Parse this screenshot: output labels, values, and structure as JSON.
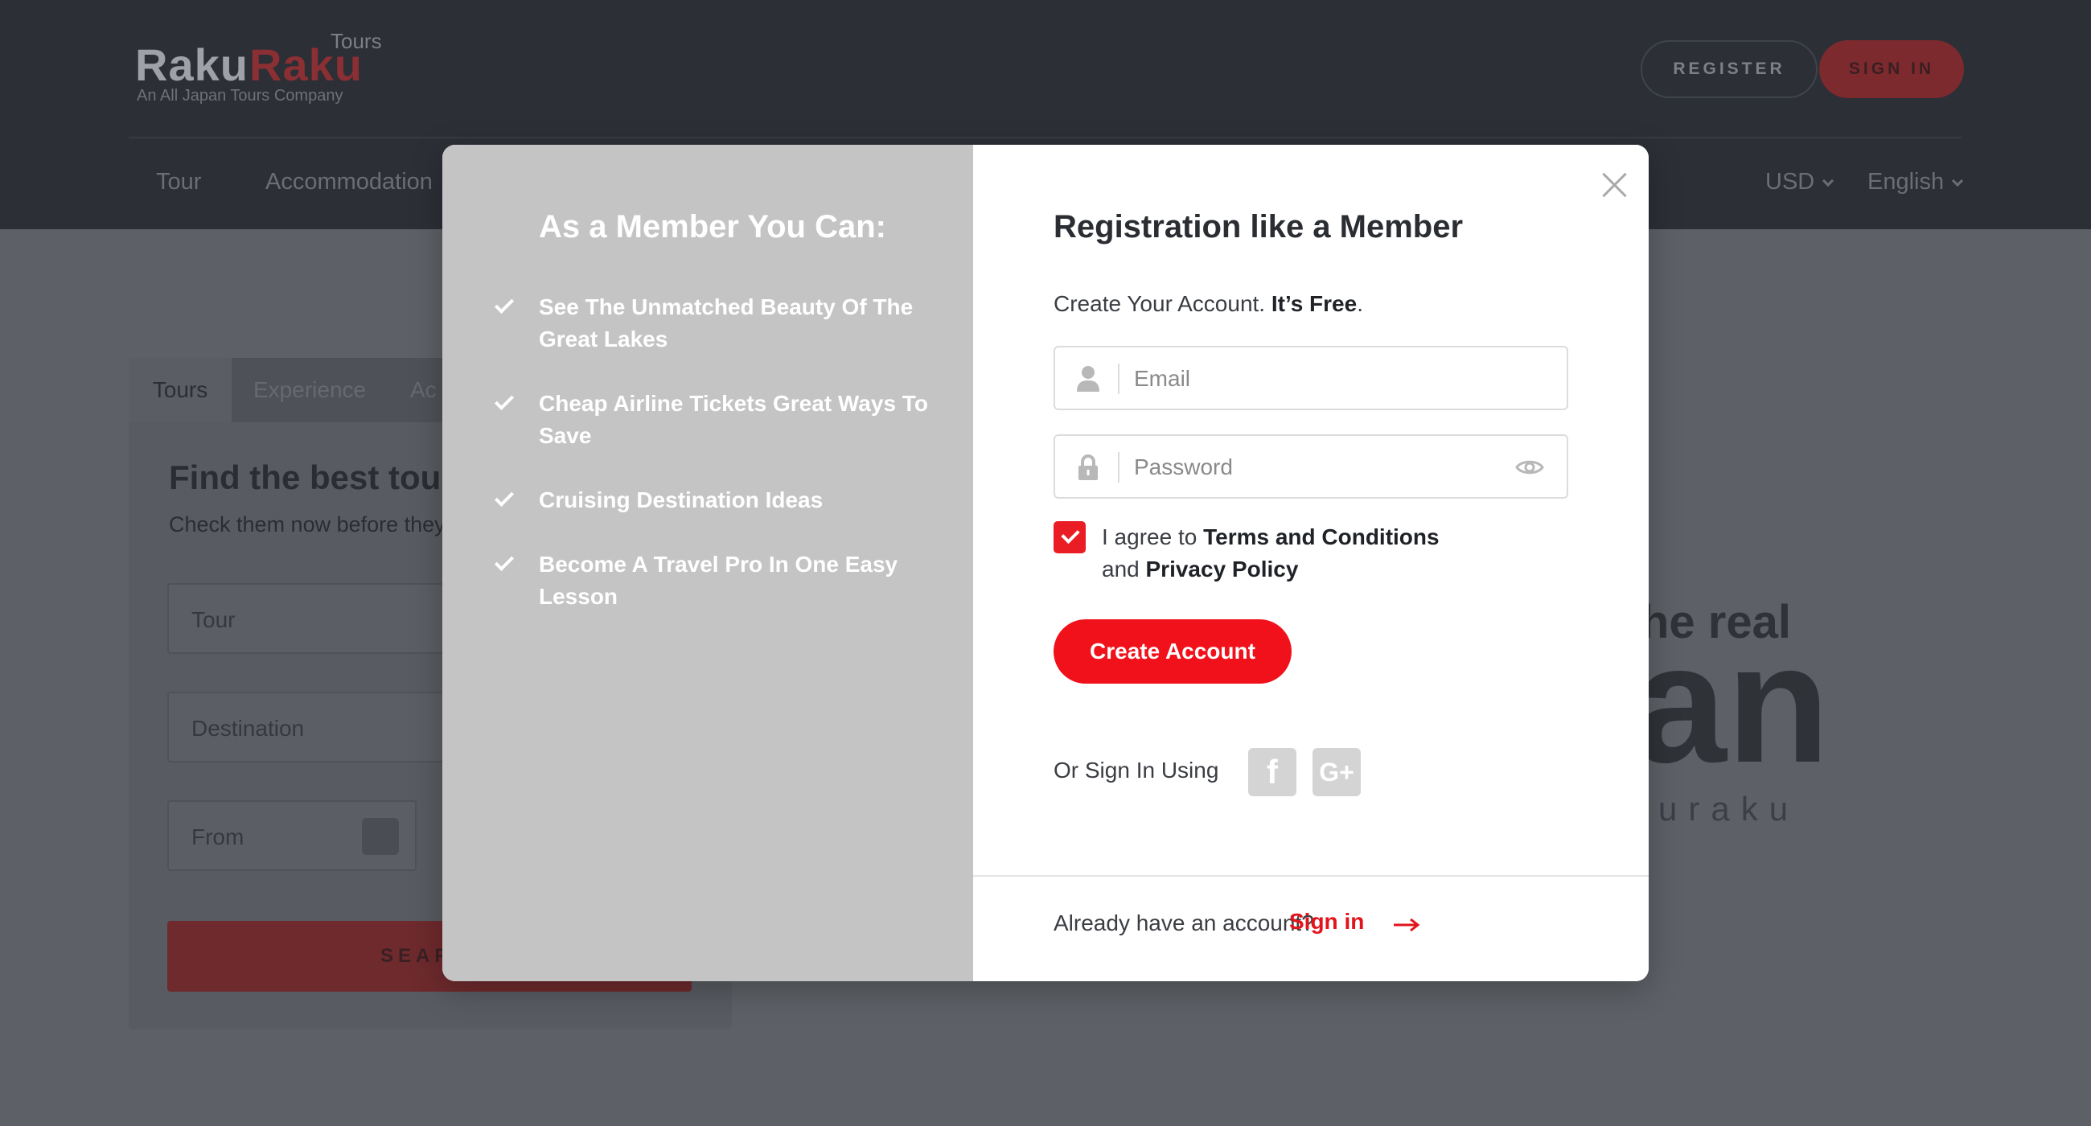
{
  "header": {
    "logo_part1": "Raku",
    "logo_part2": "Raku",
    "logo_tours": "Tours",
    "logo_tagline": "An All Japan Tours Company",
    "register_label": "REGISTER",
    "signin_label": "SIGN IN"
  },
  "nav": {
    "items": [
      "Tour",
      "Accommodation"
    ],
    "currency": "USD",
    "language": "English"
  },
  "search_card": {
    "tabs": [
      "Tours",
      "Experience",
      "Ac"
    ],
    "title": "Find the best tours",
    "subtitle": "Check them now before they",
    "fields": [
      "Tour",
      "Destination",
      "From"
    ],
    "search_label": "SEAR"
  },
  "hero": {
    "line1": "he real",
    "line2": "an",
    "line3": "uraku"
  },
  "modal": {
    "left_title": "As a Member You Can:",
    "benefits": [
      "See The Unmatched Beauty Of The Great Lakes",
      "Cheap Airline Tickets Great Ways To Save",
      "Cruising Destination Ideas",
      "Become A Travel Pro In One Easy Lesson"
    ],
    "title": "Registration like a Member",
    "subtitle_plain": "Create Your Account. ",
    "subtitle_bold": "It’s Free",
    "subtitle_end": ".",
    "email_placeholder": "Email",
    "password_placeholder": "Password",
    "agree_prefix": "I agree to ",
    "agree_terms": "Terms and Conditions",
    "agree_and": "and ",
    "agree_privacy": "Privacy Policy",
    "agree_checked": true,
    "create_label": "Create Account",
    "or_sign_in": "Or Sign In Using",
    "social_facebook": "f",
    "social_google": "G+",
    "already_text": "Already have an account?",
    "signin_link": "Sign in"
  },
  "colors": {
    "accent": "#f0111a",
    "left_panel": "#c4c4c4",
    "header_bg": "#2c2f36"
  }
}
